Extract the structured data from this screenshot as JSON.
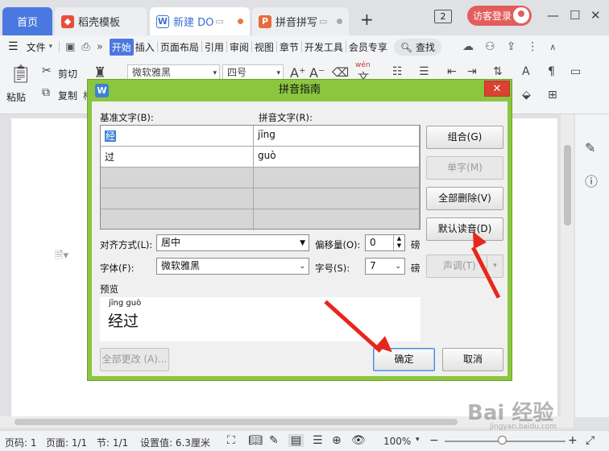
{
  "tabs": [
    {
      "label": "首页"
    },
    {
      "label": "稻壳模板"
    },
    {
      "label": "新建 DO"
    },
    {
      "label": "拼音拼写"
    }
  ],
  "titlebar": {
    "page_count": "2",
    "login_label": "访客登录"
  },
  "menu": {
    "file": "文件",
    "items": [
      "开始",
      "插入",
      "页面布局",
      "引用",
      "审阅",
      "视图",
      "章节",
      "开发工具",
      "会员专享"
    ],
    "search": "查找"
  },
  "ribbon": {
    "paste": "粘贴",
    "cut": "剪切",
    "copy": "复制",
    "format_painter_partial": "格",
    "font": "微软雅黑",
    "size": "四号",
    "wen_icon": "wén"
  },
  "dialog": {
    "title": "拼音指南",
    "base_label": "基准文字(B):",
    "pinyin_label": "拼音文字(R):",
    "rows": [
      {
        "base": "经",
        "pinyin": "jīng"
      },
      {
        "base": "过",
        "pinyin": "guò"
      },
      {
        "base": "",
        "pinyin": ""
      },
      {
        "base": "",
        "pinyin": ""
      },
      {
        "base": "",
        "pinyin": ""
      }
    ],
    "buttons": {
      "combine": "组合(G)",
      "single": "单字(M)",
      "delete_all": "全部删除(V)",
      "default_reading": "默认读音(D)",
      "tone": "声调(T)",
      "change_all": "全部更改 (A)...",
      "ok": "确定",
      "cancel": "取消"
    },
    "align_label": "对齐方式(L):",
    "align_value": "居中",
    "offset_label": "偏移量(O):",
    "offset_value": "0",
    "offset_unit": "磅",
    "font_label": "字体(F):",
    "font_value": "微软雅黑",
    "size_label": "字号(S):",
    "size_value": "7",
    "size_unit": "磅",
    "preview_label": "预览",
    "preview_pinyin": "jīng guò",
    "preview_text": "经过"
  },
  "status": {
    "page_num": "页码: 1",
    "page": "页面: 1/1",
    "section": "节: 1/1",
    "setting": "设置值: 6.3厘米",
    "zoom": "100%"
  },
  "watermark": "Bai 经验",
  "watermark_sub": "jingyan.baidu.com",
  "colors": {
    "dialog_border": "#8cc63f",
    "accent": "#4a78e0",
    "close": "#d9432f",
    "annotation_arrow": "#e8261c"
  }
}
